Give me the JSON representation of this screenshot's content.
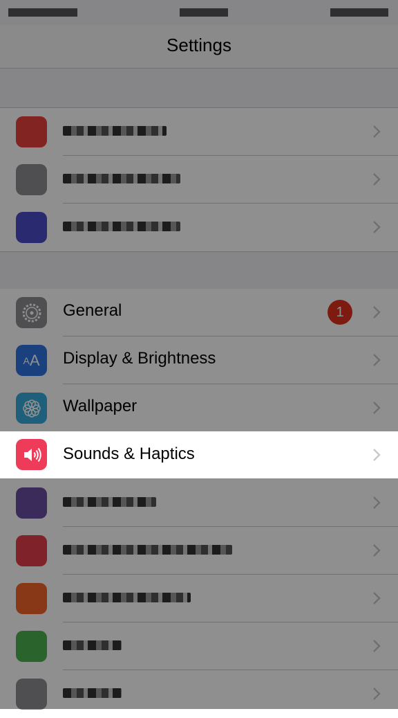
{
  "navbar": {
    "title": "Settings"
  },
  "groups": {
    "top": [
      {
        "icon": "blurred-app-icon",
        "color": "#e8413c"
      },
      {
        "icon": "blurred-app-icon",
        "color": "#8e8e93"
      },
      {
        "icon": "blurred-app-icon",
        "color": "#4c4cc9"
      }
    ],
    "system": [
      {
        "label": "General",
        "icon": "gear-icon",
        "color": "#8e8e93",
        "badge": "1"
      },
      {
        "label": "Display & Brightness",
        "icon": "text-size-icon",
        "color": "#2f73e0"
      },
      {
        "label": "Wallpaper",
        "icon": "flower-icon",
        "color": "#36aadc"
      },
      {
        "label": "Sounds & Haptics",
        "icon": "speaker-icon",
        "color": "#ee3b59"
      }
    ],
    "blurred": [
      {
        "icon": "blurred-app-icon",
        "color": "#6a4da0"
      },
      {
        "icon": "blurred-app-icon",
        "color": "#e53d4b"
      },
      {
        "icon": "blurred-app-icon",
        "color": "#f2652a"
      },
      {
        "icon": "blurred-app-icon",
        "color": "#4bb04d"
      },
      {
        "icon": "blurred-app-icon",
        "color": "#8e8e93"
      }
    ]
  },
  "colors": {
    "highlight": "#ffffff",
    "dim_overlay": "#000000",
    "badge": "#e0301e"
  }
}
